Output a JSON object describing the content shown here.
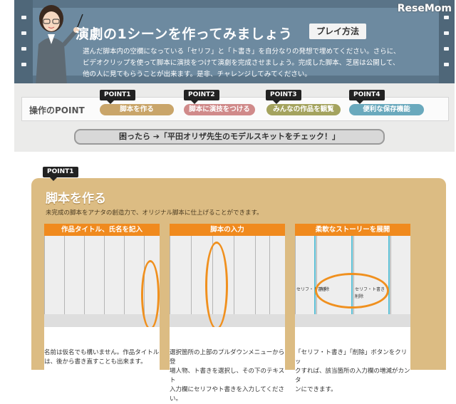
{
  "banner": {
    "title": "演劇の1シーンを作ってみましょう",
    "play_button": "プレイ方法",
    "intro_lines": [
      "選んだ脚本内の空欄になっている「セリフ」と「ト書き」を自分なりの発想で埋めてください。さらに、",
      "ビデオクリップを使って脚本に演技をつけて演劇を完成させましょう。完成した脚本、芝居は公開して、",
      "他の人に見てもらうことが出来ます。是非、チャレンジしてみてください。"
    ],
    "logo": "ReseMom"
  },
  "points_bar": {
    "label": "操作のPOINT",
    "items": [
      {
        "tag": "POINT1",
        "label": "脚本を作る",
        "color": "#c9a56a"
      },
      {
        "tag": "POINT2",
        "label": "脚本に演技をつける",
        "color": "#d08a8a"
      },
      {
        "tag": "POINT3",
        "label": "みんなの作品を観覧",
        "color": "#a4a35e"
      },
      {
        "tag": "POINT4",
        "label": "便利な保存機能",
        "color": "#6aa9bd"
      }
    ],
    "help": "困ったら ➔「平田オリザ先生のモデルスキットをチェック！」"
  },
  "point1": {
    "tag": "POINT1",
    "heading": "脚本を作る",
    "description": "未完成の脚本をアナタの創造力で、オリジナル脚本に仕上げることができます。",
    "cards": [
      {
        "title": "作品タイトル、氏名を記入",
        "text": [
          "名前は仮名でも構いません。作品タイトル",
          "は、後から書き直すことも出来ます。"
        ]
      },
      {
        "title": "脚本の入力",
        "text": [
          "選択箇所の上部のプルダウンメニューから登",
          "場人物、ト書きを選択し、その下のテキスト",
          "入力欄にセリフやト書きを入力してください。"
        ]
      },
      {
        "title": "柔軟なストーリーを展開",
        "text": [
          "「セリフ・ト書き」「削除」ボタンをクリッ",
          "クすれば、該当箇所の入力欄の増減がカンタ",
          "ンにできます。"
        ],
        "mini_labels": [
          "セリフ・ト書き",
          "削除",
          "セリフ・ト書き",
          "削除"
        ]
      }
    ]
  }
}
